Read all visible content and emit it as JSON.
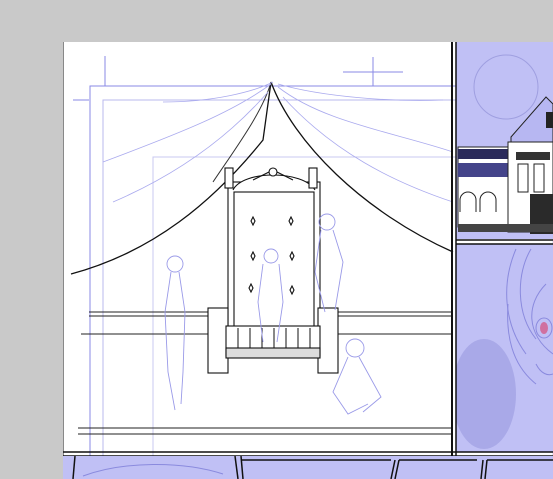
{
  "app": {
    "title": "",
    "view": "canvas"
  },
  "colors": {
    "workspace": "#c9c9c9",
    "paper": "#ffffff",
    "blue_pencil": "#8a8ae6",
    "panel_fill": "#c0c0f5",
    "ink": "#1a1a1a",
    "panel_border": "#111111"
  },
  "layers": {
    "sketch": "blue-pencil",
    "ink": "black-ink"
  },
  "panels": [
    {
      "name": "throne-room-panel"
    },
    {
      "name": "building-facade-panel"
    },
    {
      "name": "character-face-panel"
    },
    {
      "name": "bottom-strip-panels"
    }
  ]
}
